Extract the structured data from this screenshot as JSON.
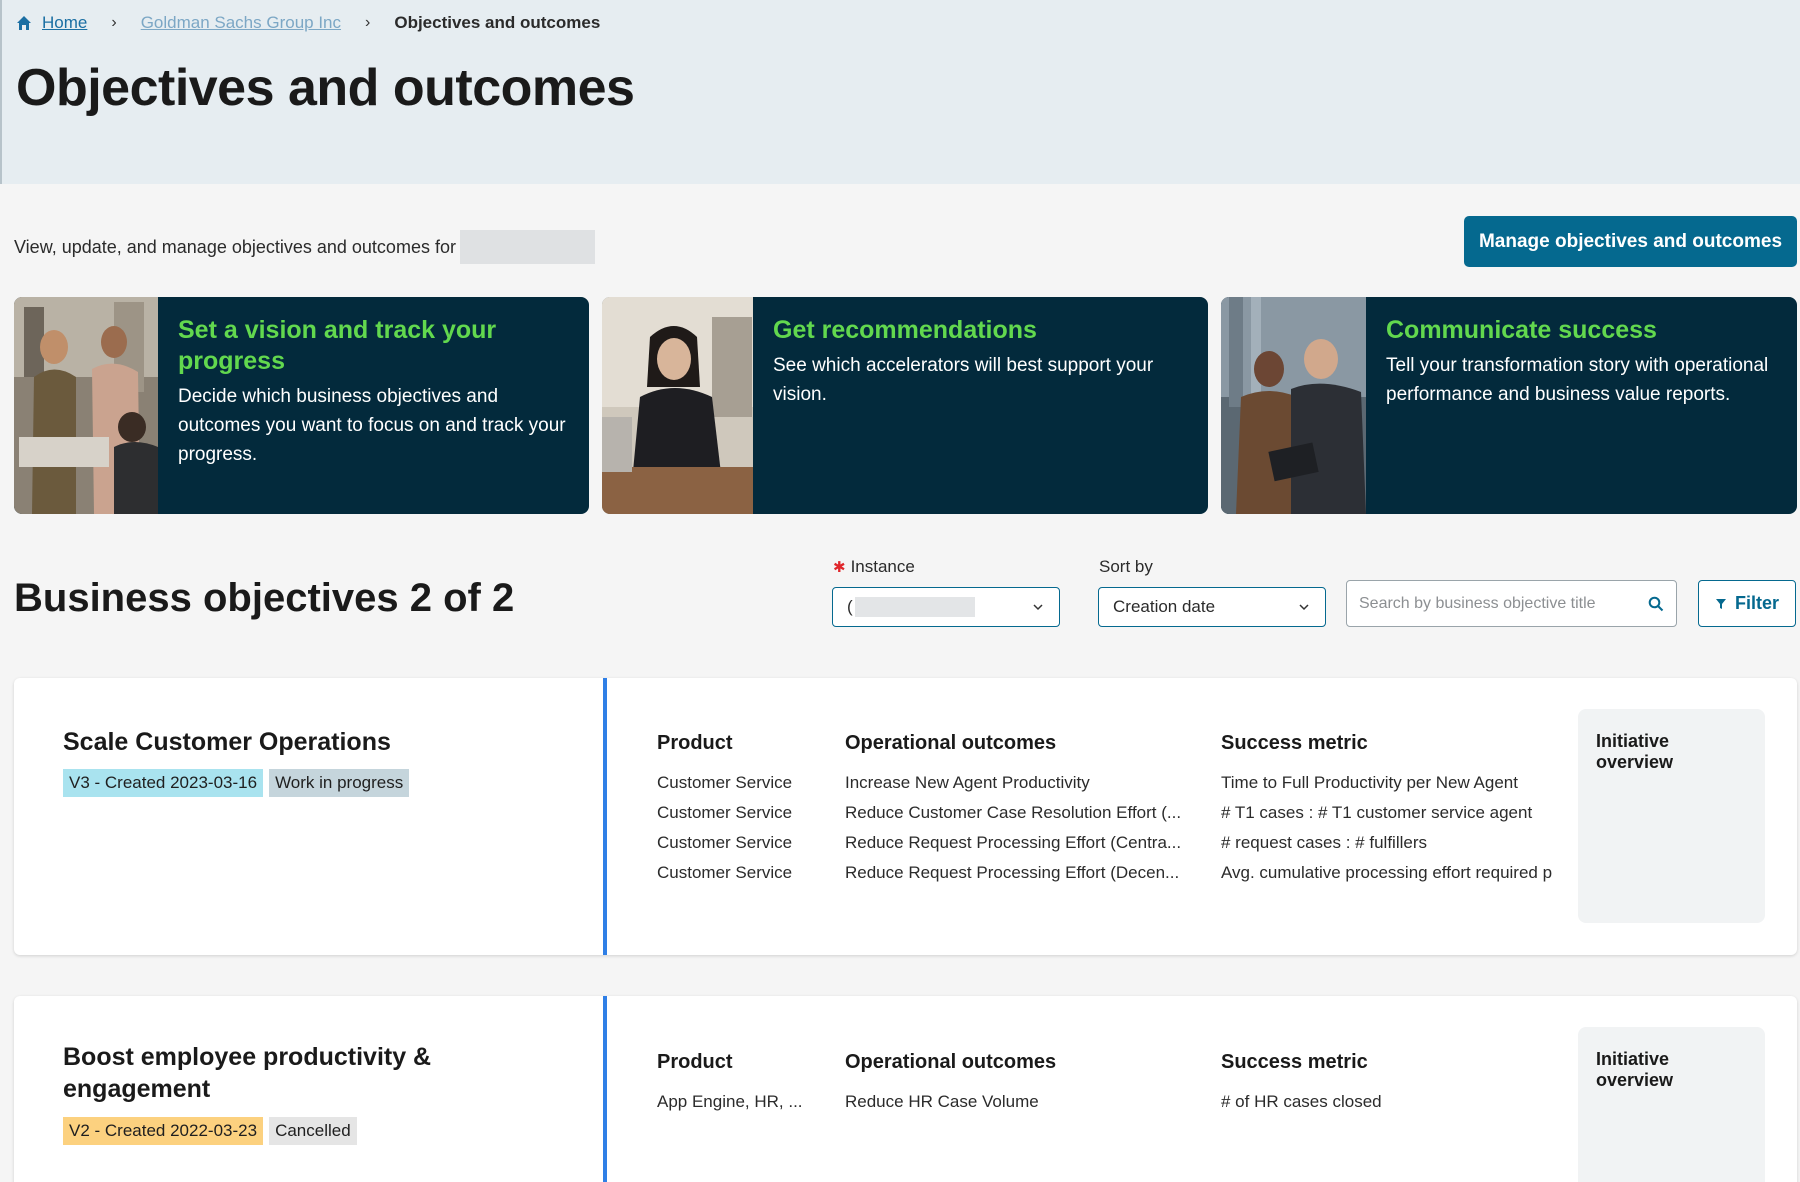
{
  "breadcrumb": {
    "home": "Home",
    "company": "Goldman Sachs Group Inc",
    "current": "Objectives and outcomes"
  },
  "page": {
    "title": "Objectives and outcomes",
    "intro": "View, update, and manage objectives and outcomes for",
    "manage_button": "Manage objectives and outcomes"
  },
  "promos": [
    {
      "title": "Set a vision and track your progress",
      "body": "Decide which business objectives and outcomes you want to focus on and track your progress."
    },
    {
      "title": "Get recommendations",
      "body": "See which accelerators will best support your vision."
    },
    {
      "title": "Communicate success",
      "body": "Tell your transformation story with operational performance and business value reports."
    }
  ],
  "section": {
    "title": "Business objectives 2 of 2",
    "instance_label": "Instance",
    "instance_value": "(",
    "sort_label": "Sort by",
    "sort_value": "Creation date",
    "search_placeholder": "Search by business objective title",
    "filter_button": "Filter"
  },
  "objectives": [
    {
      "title": "Scale Customer Operations",
      "version_tag": "V3 - Created 2023-03-16",
      "status_tag": "Work in progress",
      "headers": {
        "product": "Product",
        "outcomes": "Operational outcomes",
        "metric": "Success metric"
      },
      "products": [
        "Customer Service",
        "Customer Service",
        "Customer Service",
        "Customer Service"
      ],
      "outcomes": [
        "Increase New Agent Productivity",
        "Reduce Customer Case Resolution Effort (...",
        "Reduce Request Processing Effort (Centra...",
        "Reduce Request Processing Effort (Decen..."
      ],
      "metrics": [
        "Time to Full Productivity per New Agent",
        "# T1 cases : # T1 customer service agent",
        "# request cases : # fulfillers",
        "Avg. cumulative processing effort required p"
      ],
      "initiative": "Initiative overview"
    },
    {
      "title": "Boost employee productivity & engagement",
      "version_tag": "V2 - Created 2022-03-23",
      "status_tag": "Cancelled",
      "headers": {
        "product": "Product",
        "outcomes": "Operational outcomes",
        "metric": "Success metric"
      },
      "products": [
        "App Engine, HR, ..."
      ],
      "outcomes": [
        "Reduce HR Case Volume"
      ],
      "metrics": [
        "# of HR cases closed"
      ],
      "initiative": "Initiative overview"
    }
  ],
  "colors": {
    "accent": "#05698f",
    "promo_bg": "#032a3c",
    "promo_title": "#62d84e",
    "divider": "#2f7fe6",
    "tag_v3": "#a9e3ef",
    "tag_wip": "#c5d5dc",
    "tag_v2": "#fcd17f",
    "tag_cancelled": "#e5e5e5"
  }
}
